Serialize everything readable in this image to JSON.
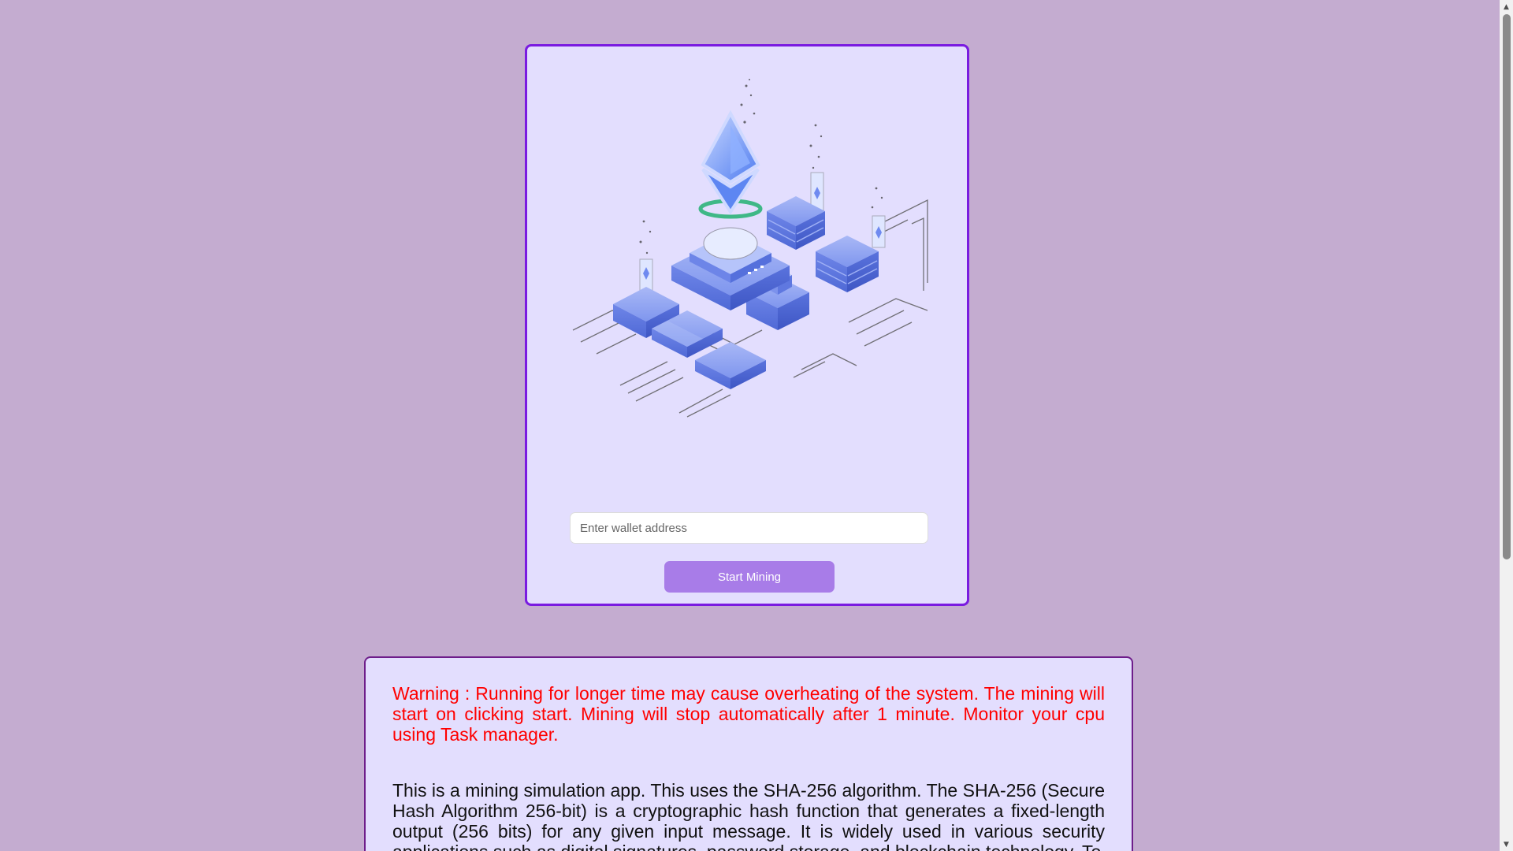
{
  "miner": {
    "illustration": "ethereum-mining-isometric-illustration",
    "wallet_placeholder": "Enter wallet address",
    "wallet_value": "",
    "start_label": "Start Mining"
  },
  "info": {
    "warning": "Warning : Running for longer time may cause overheating of the system. The mining will start on clicking start. Mining will stop automatically after 1 minute. Monitor your cpu using Task manager.",
    "description": "This is a mining simulation app. This uses the SHA-256 algorithm. The SHA-256 (Secure Hash Algorithm 256-bit) is a cryptographic hash function that generates a fixed-length output (256 bits) for any given input message. It is widely used in various security applications such as digital signatures, password storage, and blockchain technology. To"
  },
  "colors": {
    "page_background": "#c4acd0",
    "card_background": "#e3defe",
    "card_border": "#7a1be0",
    "info_border": "#6e1d8a",
    "button": "#a87ce8",
    "warning": "#ff0000"
  },
  "scrollbar": {
    "up_icon": "triangle-up-icon",
    "down_icon": "triangle-down-icon"
  }
}
